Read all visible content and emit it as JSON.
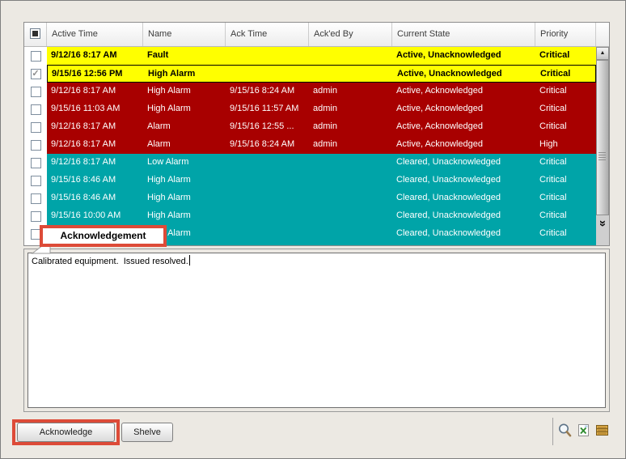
{
  "window": {
    "bg": "#ECE9E3",
    "border": "#7F7F7F"
  },
  "annotation": {
    "color": "#DD4B38"
  },
  "table": {
    "colors": {
      "yellow": "#FFFF00",
      "red": "#A80000",
      "teal": "#00A4A8"
    },
    "header": {
      "select_all_state": "partial",
      "columns": [
        "Active Time",
        "Name",
        "Ack Time",
        "Ack'ed By",
        "Current State",
        "Priority"
      ]
    },
    "rows": [
      {
        "check_glyph": "",
        "color": "yellow",
        "active_time": "9/12/16 8:17 AM",
        "name": "Fault",
        "ack_time": "",
        "acked_by": "",
        "current_state": "Active, Unacknowledged",
        "priority": "Critical"
      },
      {
        "check_glyph": "✓",
        "color": "yellow",
        "active_time": "9/15/16 12:56 PM",
        "name": "High Alarm",
        "ack_time": "",
        "acked_by": "",
        "current_state": "Active, Unacknowledged",
        "priority": "Critical"
      },
      {
        "check_glyph": "",
        "color": "red",
        "active_time": "9/12/16 8:17 AM",
        "name": "High Alarm",
        "ack_time": "9/15/16 8:24 AM",
        "acked_by": "admin",
        "current_state": "Active, Acknowledged",
        "priority": "Critical"
      },
      {
        "check_glyph": "",
        "color": "red",
        "active_time": "9/15/16 11:03 AM",
        "name": "High Alarm",
        "ack_time": "9/15/16 11:57 AM",
        "acked_by": "admin",
        "current_state": "Active, Acknowledged",
        "priority": "Critical"
      },
      {
        "check_glyph": "",
        "color": "red",
        "active_time": "9/12/16 8:17 AM",
        "name": "Alarm",
        "ack_time": "9/15/16 12:55 ...",
        "acked_by": "admin",
        "current_state": "Active, Acknowledged",
        "priority": "Critical"
      },
      {
        "check_glyph": "",
        "color": "red",
        "active_time": "9/12/16 8:17 AM",
        "name": "Alarm",
        "ack_time": "9/15/16 8:24 AM",
        "acked_by": "admin",
        "current_state": "Active, Acknowledged",
        "priority": "High"
      },
      {
        "check_glyph": "",
        "color": "teal",
        "active_time": "9/12/16 8:17 AM",
        "name": "Low Alarm",
        "ack_time": "",
        "acked_by": "",
        "current_state": "Cleared, Unacknowledged",
        "priority": "Critical"
      },
      {
        "check_glyph": "",
        "color": "teal",
        "active_time": "9/15/16 8:46 AM",
        "name": "High Alarm",
        "ack_time": "",
        "acked_by": "",
        "current_state": "Cleared, Unacknowledged",
        "priority": "Critical"
      },
      {
        "check_glyph": "",
        "color": "teal",
        "active_time": "9/15/16 8:46 AM",
        "name": "High Alarm",
        "ack_time": "",
        "acked_by": "",
        "current_state": "Cleared, Unacknowledged",
        "priority": "Critical"
      },
      {
        "check_glyph": "",
        "color": "teal",
        "active_time": "9/15/16 10:00 AM",
        "name": "High Alarm",
        "ack_time": "",
        "acked_by": "",
        "current_state": "Cleared, Unacknowledged",
        "priority": "Critical"
      },
      {
        "check_glyph": "",
        "color": "teal",
        "active_time": "",
        "name": "High Alarm",
        "ack_time": "",
        "acked_by": "",
        "current_state": "Cleared, Unacknowledged",
        "priority": "Critical"
      }
    ],
    "scrollbar": {
      "up_glyph": "▲",
      "more_glyph": "»"
    }
  },
  "tooltip": {
    "label": "Acknowledgement"
  },
  "notes": {
    "text": "Calibrated equipment.  Issued resolved."
  },
  "actions": {
    "acknowledge": "Acknowledge",
    "shelve": "Shelve"
  }
}
